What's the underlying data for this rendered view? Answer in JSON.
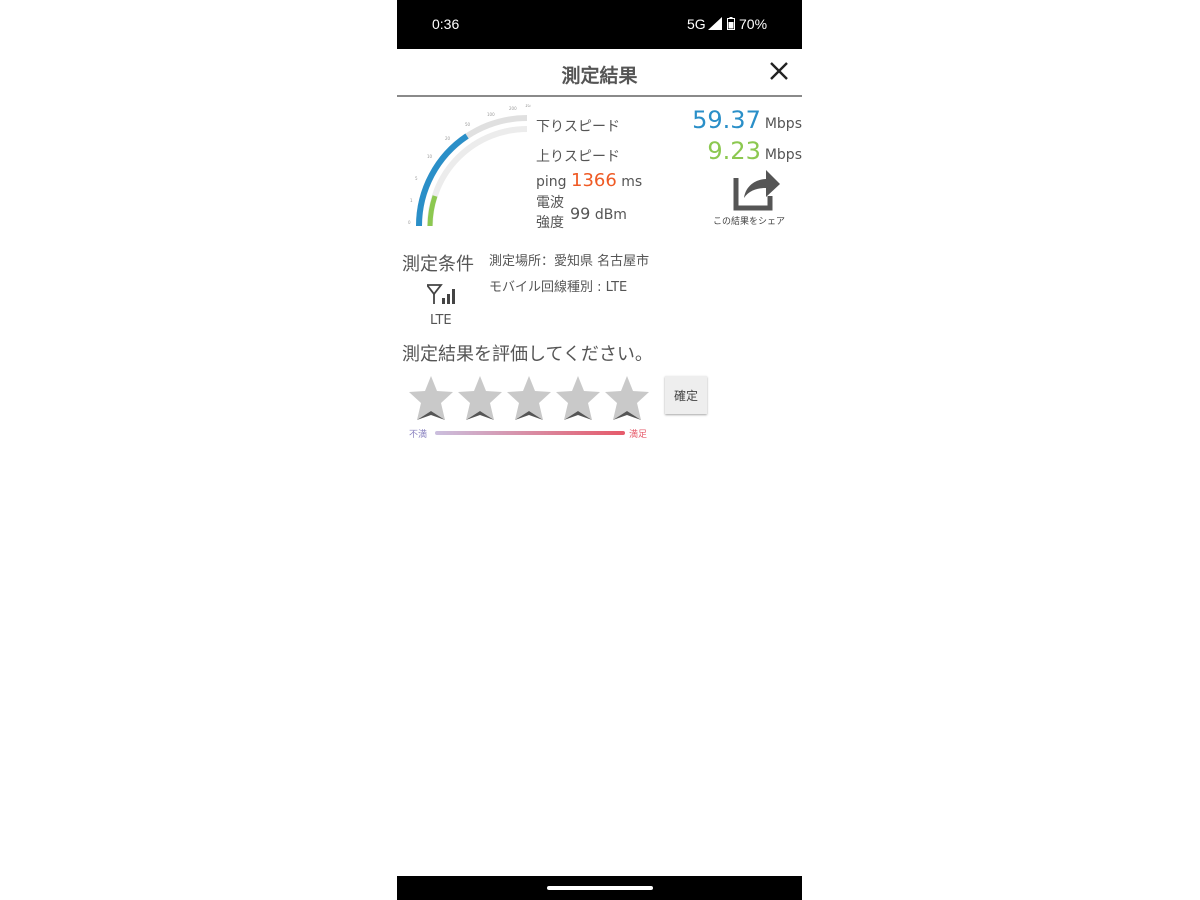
{
  "status_bar": {
    "time": "0:36",
    "network": "5G",
    "battery": "70%"
  },
  "header": {
    "title": "測定結果",
    "close_icon": "close-icon"
  },
  "results": {
    "download_label": "下りスピード",
    "download_value": "59.37",
    "download_unit": "Mbps",
    "upload_label": "上りスピード",
    "upload_value": "9.23",
    "upload_unit": "Mbps",
    "ping_label": "ping",
    "ping_value": "1366",
    "ping_unit": "ms",
    "signal_label_line1": "電波",
    "signal_label_line2": "強度",
    "signal_value": "99",
    "signal_unit": "dBm",
    "share_label": "この結果をシェア",
    "colors": {
      "download": "#2a8fc8",
      "upload": "#8cc850",
      "ping": "#ef5a24"
    }
  },
  "conditions": {
    "title": "測定条件",
    "network_type": "LTE",
    "location": "測定場所：愛知県 名古屋市",
    "mobile_line": "モバイル回線種別 : LTE"
  },
  "rating": {
    "prompt": "測定結果を評価してください。",
    "star_count": 5,
    "confirm_label": "確定",
    "scale_low": "不満",
    "scale_high": "満足"
  }
}
